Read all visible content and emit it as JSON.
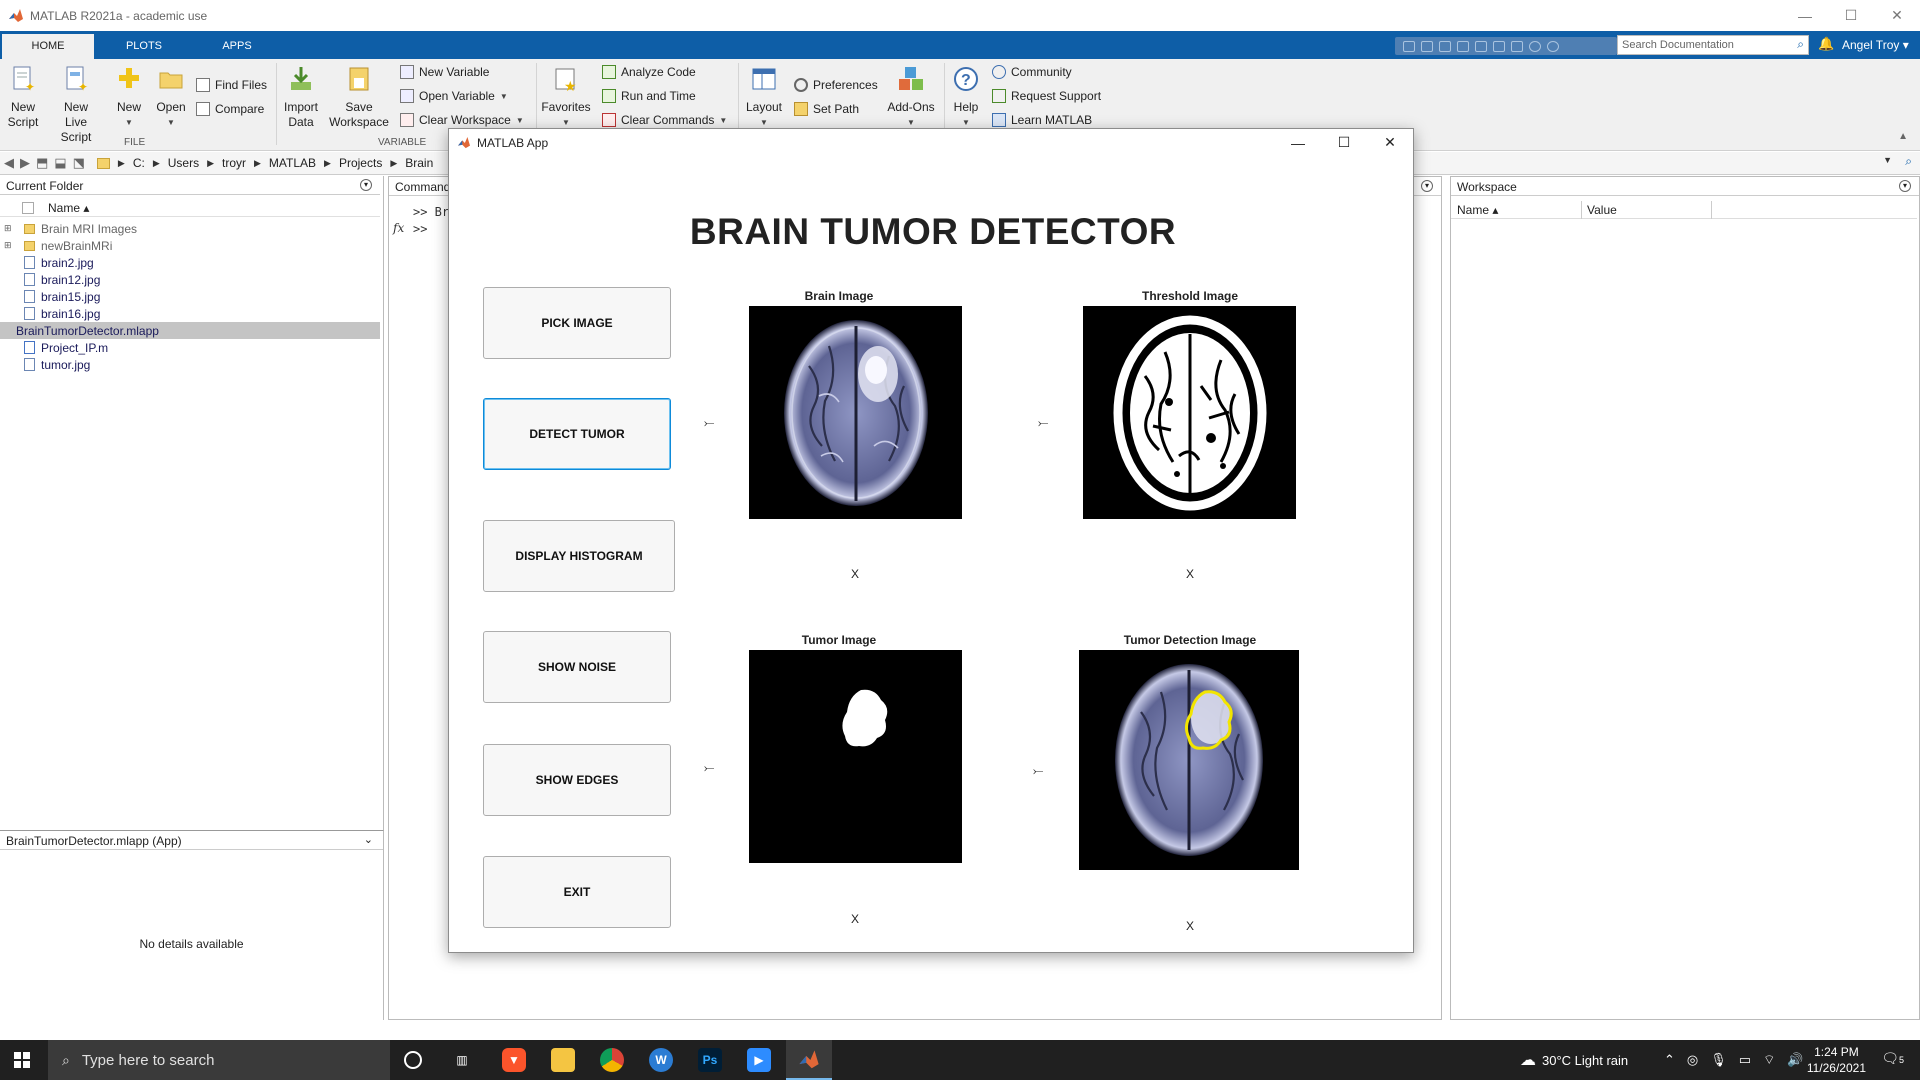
{
  "window": {
    "title": "MATLAB R2021a - academic use"
  },
  "ribbon_tabs": [
    "HOME",
    "PLOTS",
    "APPS"
  ],
  "search_doc_placeholder": "Search Documentation",
  "user_name": "Angel Troy",
  "ribbon": {
    "new_script": "New\nScript",
    "new_script_l1": "New",
    "new_script_l2": "Script",
    "new_live_l1": "New",
    "new_live_l2": "Live Script",
    "new": "New",
    "open": "Open",
    "find_files": "Find Files",
    "compare": "Compare",
    "file_section": "FILE",
    "import_l1": "Import",
    "import_l2": "Data",
    "save_l1": "Save",
    "save_l2": "Workspace",
    "new_variable": "New Variable",
    "open_variable": "Open Variable",
    "clear_workspace": "Clear Workspace",
    "variable_section": "VARIABLE",
    "favorites": "Favorites",
    "analyze_code": "Analyze Code",
    "run_and_time": "Run and Time",
    "clear_commands": "Clear Commands",
    "layout": "Layout",
    "preferences": "Preferences",
    "set_path": "Set Path",
    "addons": "Add-Ons",
    "help": "Help",
    "community": "Community",
    "request_support": "Request Support",
    "learn_matlab": "Learn MATLAB"
  },
  "address": {
    "path": [
      "C:",
      "Users",
      "troyr",
      "MATLAB",
      "Projects",
      "Brain"
    ]
  },
  "current_folder": {
    "title": "Current Folder",
    "name_col": "Name ▴",
    "items": [
      {
        "name": "Brain MRI Images",
        "type": "folder"
      },
      {
        "name": "newBrainMRi",
        "type": "folder"
      },
      {
        "name": "brain2.jpg",
        "type": "file"
      },
      {
        "name": "brain12.jpg",
        "type": "file"
      },
      {
        "name": "brain15.jpg",
        "type": "file"
      },
      {
        "name": "brain16.jpg",
        "type": "file"
      },
      {
        "name": "BrainTumorDetector.mlapp",
        "type": "app"
      },
      {
        "name": "Project_IP.m",
        "type": "m"
      },
      {
        "name": "tumor.jpg",
        "type": "file"
      }
    ]
  },
  "details": {
    "title": "BrainTumorDetector.mlapp  (App)",
    "empty": "No details available"
  },
  "command_window": {
    "title": "Command",
    "line1": ">> Br",
    "line2": ">>",
    "fx": "fx"
  },
  "workspace": {
    "title": "Workspace",
    "col_name": "Name ▴",
    "col_value": "Value"
  },
  "app": {
    "title": "MATLAB App",
    "heading": "BRAIN TUMOR DETECTOR",
    "buttons": {
      "pick": "PICK IMAGE",
      "detect": "DETECT TUMOR",
      "histogram": "DISPLAY HISTOGRAM",
      "noise": "SHOW NOISE",
      "edges": "SHOW EDGES",
      "exit": "EXIT"
    },
    "captions": {
      "brain": "Brain Image",
      "threshold": "Threshold Image",
      "tumor": "Tumor Image",
      "detection": "Tumor Detection Image"
    },
    "x_label": "X",
    "arrow": "⤚"
  },
  "taskbar": {
    "search_placeholder": "Type here to search",
    "weather": "30°C  Light rain",
    "time": "1:24 PM",
    "date": "11/26/2021",
    "notifications": "5",
    "ps_label": "Ps"
  },
  "colors": {
    "ribbon_blue": "#0e5ea7",
    "focus_blue": "#0e8ad9",
    "tumor_outline": "#f2e500"
  }
}
